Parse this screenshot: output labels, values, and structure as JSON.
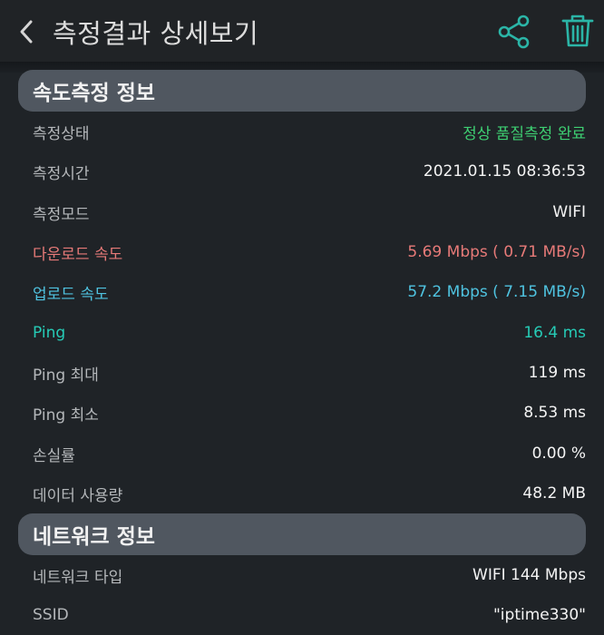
{
  "header": {
    "title": "측정결과 상세보기"
  },
  "colors": {
    "accent": "#2bb5a7",
    "good": "#3ecf72",
    "download": "#e77a78",
    "upload": "#4fc3e0",
    "ping": "#26cbb6"
  },
  "sections": {
    "speed": {
      "title": "속도측정 정보",
      "rows": [
        {
          "label": "측정상태",
          "value": "정상 품질측정 완료"
        },
        {
          "label": "측정시간",
          "value": "2021.01.15 08:36:53"
        },
        {
          "label": "측정모드",
          "value": "WIFI"
        },
        {
          "label": "다운로드 속도",
          "value": "5.69 Mbps ( 0.71 MB/s)"
        },
        {
          "label": "업로드 속도",
          "value": "57.2 Mbps ( 7.15 MB/s)"
        },
        {
          "label": "Ping",
          "value": "16.4 ms"
        },
        {
          "label": "Ping 최대",
          "value": "119 ms"
        },
        {
          "label": "Ping 최소",
          "value": "8.53 ms"
        },
        {
          "label": "손실률",
          "value": "0.00 %"
        },
        {
          "label": "데이터 사용량",
          "value": "48.2 MB"
        }
      ]
    },
    "network": {
      "title": "네트워크 정보",
      "rows": [
        {
          "label": "네트워크 타입",
          "value": "WIFI 144 Mbps"
        },
        {
          "label": "SSID",
          "value": "\"iptime330\""
        }
      ]
    }
  },
  "icons": {
    "back": "chevron-left-icon",
    "share": "share-icon",
    "delete": "trash-icon"
  }
}
